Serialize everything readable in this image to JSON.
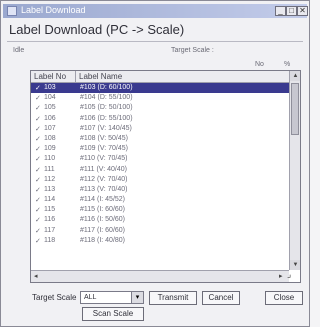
{
  "window": {
    "title": "Label Download"
  },
  "heading": "Label Download (PC -> Scale)",
  "status": {
    "state": "Idle",
    "target_label": "Target Scale :"
  },
  "columns_right": {
    "no": "No",
    "pct": "%"
  },
  "list": {
    "headers": [
      "Label No",
      "Label Name"
    ],
    "rows": [
      {
        "no": "103",
        "name": "#103 (D: 60/100)",
        "checked": true,
        "selected": true
      },
      {
        "no": "104",
        "name": "#104 (D: 55/100)",
        "checked": true,
        "selected": false
      },
      {
        "no": "105",
        "name": "#105 (D: 50/100)",
        "checked": true,
        "selected": false
      },
      {
        "no": "106",
        "name": "#106 (D: 55/100)",
        "checked": true,
        "selected": false
      },
      {
        "no": "107",
        "name": "#107 (V: 140/45)",
        "checked": true,
        "selected": false
      },
      {
        "no": "108",
        "name": "#108 (V: 50/45)",
        "checked": true,
        "selected": false
      },
      {
        "no": "109",
        "name": "#109 (V: 70/45)",
        "checked": true,
        "selected": false
      },
      {
        "no": "110",
        "name": "#110 (V: 70/45)",
        "checked": true,
        "selected": false
      },
      {
        "no": "111",
        "name": "#111 (V: 40/40)",
        "checked": true,
        "selected": false
      },
      {
        "no": "112",
        "name": "#112 (V: 70/40)",
        "checked": true,
        "selected": false
      },
      {
        "no": "113",
        "name": "#113 (V: 70/40)",
        "checked": true,
        "selected": false
      },
      {
        "no": "114",
        "name": "#114 (I: 45/52)",
        "checked": true,
        "selected": false
      },
      {
        "no": "115",
        "name": "#115 (I: 60/60)",
        "checked": true,
        "selected": false
      },
      {
        "no": "116",
        "name": "#116 (I: 50/60)",
        "checked": true,
        "selected": false
      },
      {
        "no": "117",
        "name": "#117 (I: 60/60)",
        "checked": true,
        "selected": false
      },
      {
        "no": "118",
        "name": "#118 (I: 40/80)",
        "checked": true,
        "selected": false
      }
    ]
  },
  "footer": {
    "target_scale_label": "Target Scale",
    "target_scale_value": "ALL",
    "transmit": "Transmit",
    "cancel": "Cancel",
    "close": "Close",
    "scan_scale": "Scan Scale"
  },
  "colors": {
    "titlebar": "#9aa8cf",
    "selection": "#3a3a8f"
  }
}
